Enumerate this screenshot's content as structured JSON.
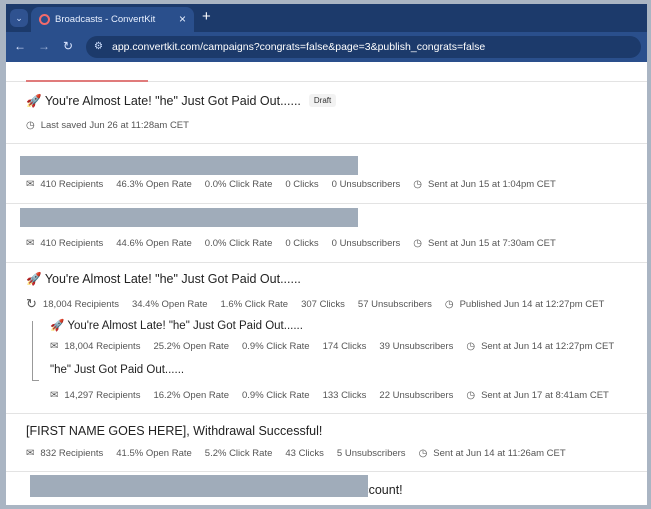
{
  "browser": {
    "tab_title": "Broadcasts - ConvertKit",
    "url": "app.convertkit.com/campaigns?congrats=false&page=3&publish_congrats=false"
  },
  "broadcasts": [
    {
      "title": "You're Almost Late! \"he\" Just Got Paid Out......",
      "badge": "Draft",
      "saved": "Last saved Jun 26 at 11:28am CET"
    },
    {
      "recipients": "410 Recipients",
      "open": "46.3% Open Rate",
      "click": "0.0% Click Rate",
      "clicks": "0 Clicks",
      "unsubs": "0 Unsubscribers",
      "sent": "Sent at Jun 15 at 1:04pm CET"
    },
    {
      "recipients": "410 Recipients",
      "open": "44.6% Open Rate",
      "click": "0.0% Click Rate",
      "clicks": "0 Clicks",
      "unsubs": "0 Unsubscribers",
      "sent": "Sent at Jun 15 at 7:30am CET"
    },
    {
      "title": "You're Almost Late! \"he\" Just Got Paid Out......",
      "recipients": "18,004 Recipients",
      "open": "34.4% Open Rate",
      "click": "1.6% Click Rate",
      "clicks": "307 Clicks",
      "unsubs": "57 Unsubscribers",
      "sent": "Published Jun 14 at 12:27pm CET",
      "children": [
        {
          "title": "You're Almost Late! \"he\" Just Got Paid Out......",
          "recipients": "18,004 Recipients",
          "open": "25.2% Open Rate",
          "click": "0.9% Click Rate",
          "clicks": "174 Clicks",
          "unsubs": "39 Unsubscribers",
          "sent": "Sent at Jun 14 at 12:27pm CET"
        },
        {
          "title": "\"he\" Just Got Paid Out......",
          "recipients": "14,297 Recipients",
          "open": "16.2% Open Rate",
          "click": "0.9% Click Rate",
          "clicks": "133 Clicks",
          "unsubs": "22 Unsubscribers",
          "sent": "Sent at Jun 17 at 8:41am CET"
        }
      ]
    },
    {
      "title": "[FIRST NAME GOES HERE], Withdrawal Successful!",
      "recipients": "832 Recipients",
      "open": "41.5% Open Rate",
      "click": "5.2% Click Rate",
      "clicks": "43 Clicks",
      "unsubs": "5 Unsubscribers",
      "sent": "Sent at Jun 14 at 11:26am CET"
    },
    {
      "title_visible": "Account!"
    }
  ]
}
